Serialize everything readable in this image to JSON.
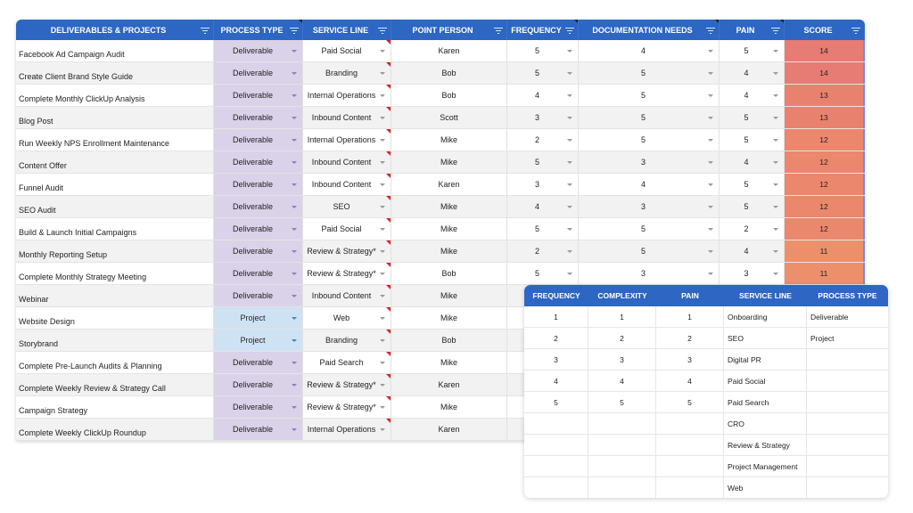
{
  "main_table": {
    "headers": {
      "name": "DELIVERABLES & PROJECTS",
      "process_type": "PROCESS TYPE",
      "service_line": "SERVICE LINE",
      "point_person": "POINT PERSON",
      "frequency": "FREQUENCY",
      "documentation_needs": "DOCUMENTATION NEEDS",
      "pain": "PAIN",
      "score": "SCORE"
    },
    "rows": [
      {
        "name": "Facebook Ad Campaign Audit",
        "process_type": "Deliverable",
        "service_line": "Paid Social",
        "point_person": "Karen",
        "frequency": "5",
        "documentation_needs": "4",
        "pain": "5",
        "score": "14"
      },
      {
        "name": "Create Client Brand Style Guide",
        "process_type": "Deliverable",
        "service_line": "Branding",
        "point_person": "Bob",
        "frequency": "5",
        "documentation_needs": "5",
        "pain": "4",
        "score": "14"
      },
      {
        "name": "Complete Monthly ClickUp Analysis",
        "process_type": "Deliverable",
        "service_line": "Internal Operations",
        "point_person": "Bob",
        "frequency": "4",
        "documentation_needs": "5",
        "pain": "4",
        "score": "13"
      },
      {
        "name": "Blog Post",
        "process_type": "Deliverable",
        "service_line": "Inbound Content",
        "point_person": "Scott",
        "frequency": "3",
        "documentation_needs": "5",
        "pain": "5",
        "score": "13"
      },
      {
        "name": "Run Weekly NPS Enrollment Maintenance",
        "process_type": "Deliverable",
        "service_line": "Internal Operations",
        "point_person": "Mike",
        "frequency": "2",
        "documentation_needs": "5",
        "pain": "5",
        "score": "12"
      },
      {
        "name": "Content Offer",
        "process_type": "Deliverable",
        "service_line": "Inbound Content",
        "point_person": "Mike",
        "frequency": "5",
        "documentation_needs": "3",
        "pain": "4",
        "score": "12"
      },
      {
        "name": "Funnel Audit",
        "process_type": "Deliverable",
        "service_line": "Inbound Content",
        "point_person": "Karen",
        "frequency": "3",
        "documentation_needs": "4",
        "pain": "5",
        "score": "12"
      },
      {
        "name": "SEO Audit",
        "process_type": "Deliverable",
        "service_line": "SEO",
        "point_person": "Mike",
        "frequency": "4",
        "documentation_needs": "3",
        "pain": "5",
        "score": "12"
      },
      {
        "name": "Build & Launch Initial Campaigns",
        "process_type": "Deliverable",
        "service_line": "Paid Social",
        "point_person": "Mike",
        "frequency": "5",
        "documentation_needs": "5",
        "pain": "2",
        "score": "12"
      },
      {
        "name": "Monthly Reporting Setup",
        "process_type": "Deliverable",
        "service_line": "Review & Strategy*",
        "point_person": "Mike",
        "frequency": "2",
        "documentation_needs": "5",
        "pain": "4",
        "score": "11"
      },
      {
        "name": "Complete Monthly Strategy Meeting",
        "process_type": "Deliverable",
        "service_line": "Review & Strategy*",
        "point_person": "Bob",
        "frequency": "5",
        "documentation_needs": "3",
        "pain": "3",
        "score": "11"
      },
      {
        "name": "Webinar",
        "process_type": "Deliverable",
        "service_line": "Inbound Content",
        "point_person": "Mike",
        "frequency": "",
        "documentation_needs": "",
        "pain": "",
        "score": ""
      },
      {
        "name": "Website Design",
        "process_type": "Project",
        "service_line": "Web",
        "point_person": "Mike",
        "frequency": "",
        "documentation_needs": "",
        "pain": "",
        "score": ""
      },
      {
        "name": "Storybrand",
        "process_type": "Project",
        "service_line": "Branding",
        "point_person": "Bob",
        "frequency": "",
        "documentation_needs": "",
        "pain": "",
        "score": ""
      },
      {
        "name": "Complete Pre-Launch Audits & Planning",
        "process_type": "Deliverable",
        "service_line": "Paid Search",
        "point_person": "Mike",
        "frequency": "",
        "documentation_needs": "",
        "pain": "",
        "score": ""
      },
      {
        "name": "Complete Weekly Review & Strategy Call",
        "process_type": "Deliverable",
        "service_line": "Review & Strategy*",
        "point_person": "Karen",
        "frequency": "",
        "documentation_needs": "",
        "pain": "",
        "score": ""
      },
      {
        "name": "Campaign Strategy",
        "process_type": "Deliverable",
        "service_line": "Review & Strategy*",
        "point_person": "Mike",
        "frequency": "",
        "documentation_needs": "",
        "pain": "",
        "score": ""
      },
      {
        "name": "Complete Weekly ClickUp Roundup",
        "process_type": "Deliverable",
        "service_line": "Internal Operations",
        "point_person": "Karen",
        "frequency": "",
        "documentation_needs": "",
        "pain": "",
        "score": ""
      }
    ]
  },
  "lookup_table": {
    "headers": {
      "frequency": "FREQUENCY",
      "complexity": "COMPLEXITY",
      "pain": "PAIN",
      "service_line": "SERVICE LINE",
      "process_type": "PROCESS TYPE"
    },
    "rows": [
      {
        "frequency": "1",
        "complexity": "1",
        "pain": "1",
        "service_line": "Onboarding",
        "process_type": "Deliverable"
      },
      {
        "frequency": "2",
        "complexity": "2",
        "pain": "2",
        "service_line": "SEO",
        "process_type": "Project"
      },
      {
        "frequency": "3",
        "complexity": "3",
        "pain": "3",
        "service_line": "Digital PR",
        "process_type": ""
      },
      {
        "frequency": "4",
        "complexity": "4",
        "pain": "4",
        "service_line": "Paid Social",
        "process_type": ""
      },
      {
        "frequency": "5",
        "complexity": "5",
        "pain": "5",
        "service_line": "Paid Search",
        "process_type": ""
      },
      {
        "frequency": "",
        "complexity": "",
        "pain": "",
        "service_line": "CRO",
        "process_type": ""
      },
      {
        "frequency": "",
        "complexity": "",
        "pain": "",
        "service_line": "Review & Strategy",
        "process_type": ""
      },
      {
        "frequency": "",
        "complexity": "",
        "pain": "",
        "service_line": "Project Management",
        "process_type": ""
      },
      {
        "frequency": "",
        "complexity": "",
        "pain": "",
        "service_line": "Web",
        "process_type": ""
      }
    ]
  },
  "colors": {
    "header_bg": "#2d66c3",
    "deliverable_bg": "#d9d2e9",
    "project_bg": "#cfe2f3",
    "score_14": "#e67c73",
    "score_13": "#e8826f",
    "score_12": "#ea876c",
    "score_11": "#ec906b"
  }
}
